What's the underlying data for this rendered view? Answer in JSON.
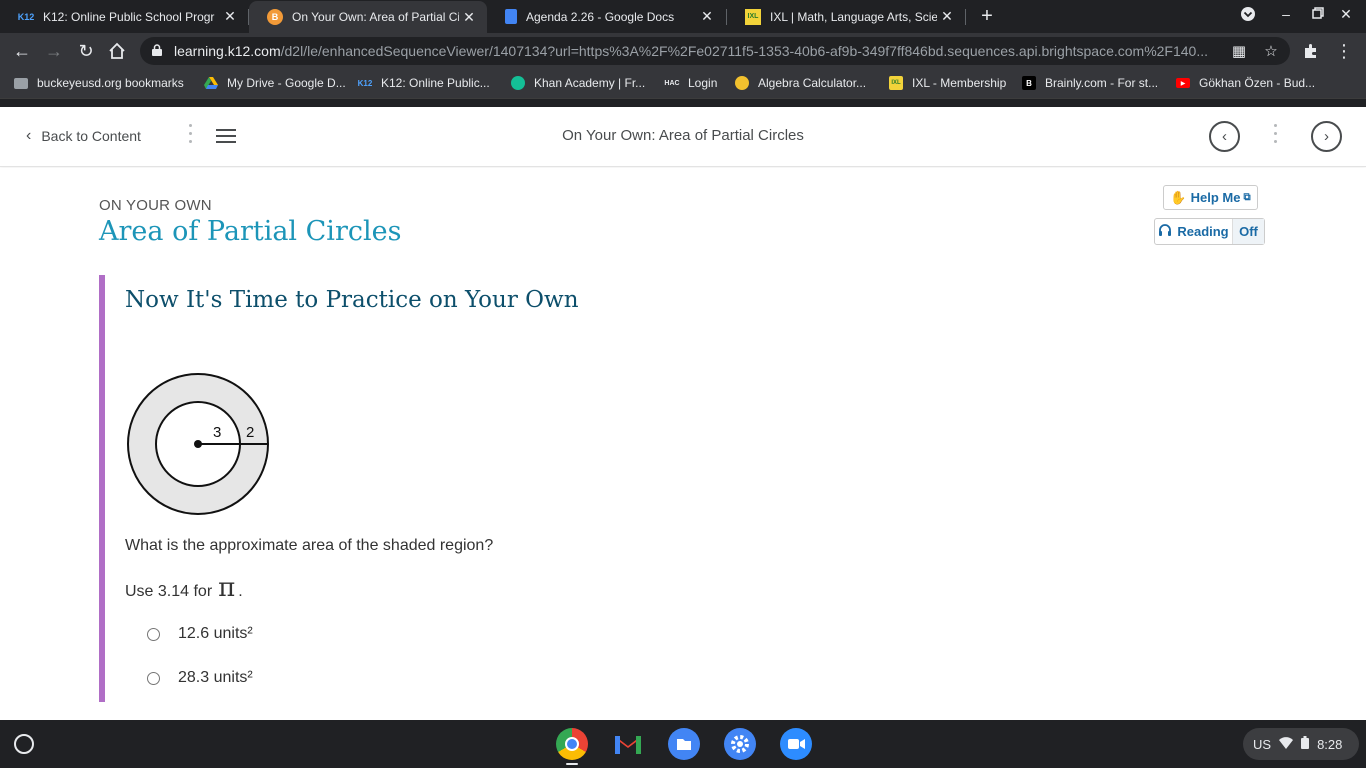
{
  "browser": {
    "tabs": [
      {
        "favicon": "K12",
        "title": "K12: Online Public School Progr",
        "active": false
      },
      {
        "favicon": "B",
        "title": "On Your Own: Area of Partial Circ",
        "active": true
      },
      {
        "favicon": "docs",
        "title": "Agenda 2.26 - Google Docs",
        "active": false
      },
      {
        "favicon": "IXL",
        "title": "IXL | Math, Language Arts, Scien",
        "active": false
      }
    ],
    "url_host": "learning.k12.com",
    "url_path": "/d2l/le/enhancedSequenceViewer/1407134?url=https%3A%2F%2Fe02711f5-1353-40b6-af9b-349f7ff846bd.sequences.api.brightspace.com%2F140...",
    "bookmarks": [
      {
        "icon": "folder",
        "label": "buckeyeusd.org bookmarks"
      },
      {
        "icon": "drive",
        "label": "My Drive - Google D..."
      },
      {
        "icon": "K12",
        "label": "K12: Online Public..."
      },
      {
        "icon": "khan",
        "label": "Khan Academy | Fr..."
      },
      {
        "icon": "HAC",
        "label": "Login"
      },
      {
        "icon": "calc",
        "label": "Algebra Calculator..."
      },
      {
        "icon": "IXL",
        "label": "IXL - Membership"
      },
      {
        "icon": "B",
        "label": "Brainly.com - For st..."
      },
      {
        "icon": "youtube",
        "label": "Gökhan Özen - Bud..."
      }
    ]
  },
  "header": {
    "back_label": "Back to Content",
    "title": "On Your Own: Area of Partial Circles"
  },
  "lesson": {
    "kicker": "ON YOUR OWN",
    "title": "Area of Partial Circles",
    "help_label": "Help Me",
    "reading_label": "Reading",
    "reading_state": "Off"
  },
  "practice": {
    "heading": "Now It's Time to Practice on Your Own",
    "figure": {
      "inner_radius_label": "3",
      "ring_width_label": "2"
    },
    "question": "What is the approximate area of the shaded region?",
    "use_prefix": "Use 3.14 for",
    "pi_symbol": "π",
    "use_suffix": ".",
    "options": [
      "12.6 units²",
      "28.3 units²"
    ]
  },
  "shelf": {
    "locale": "US",
    "time": "8:28"
  },
  "colors": {
    "accent_title": "#1c95b8",
    "panel_border": "#b06ec6",
    "panel_heading": "#0d4f6b",
    "shaded_region": "#e6e6e6"
  }
}
